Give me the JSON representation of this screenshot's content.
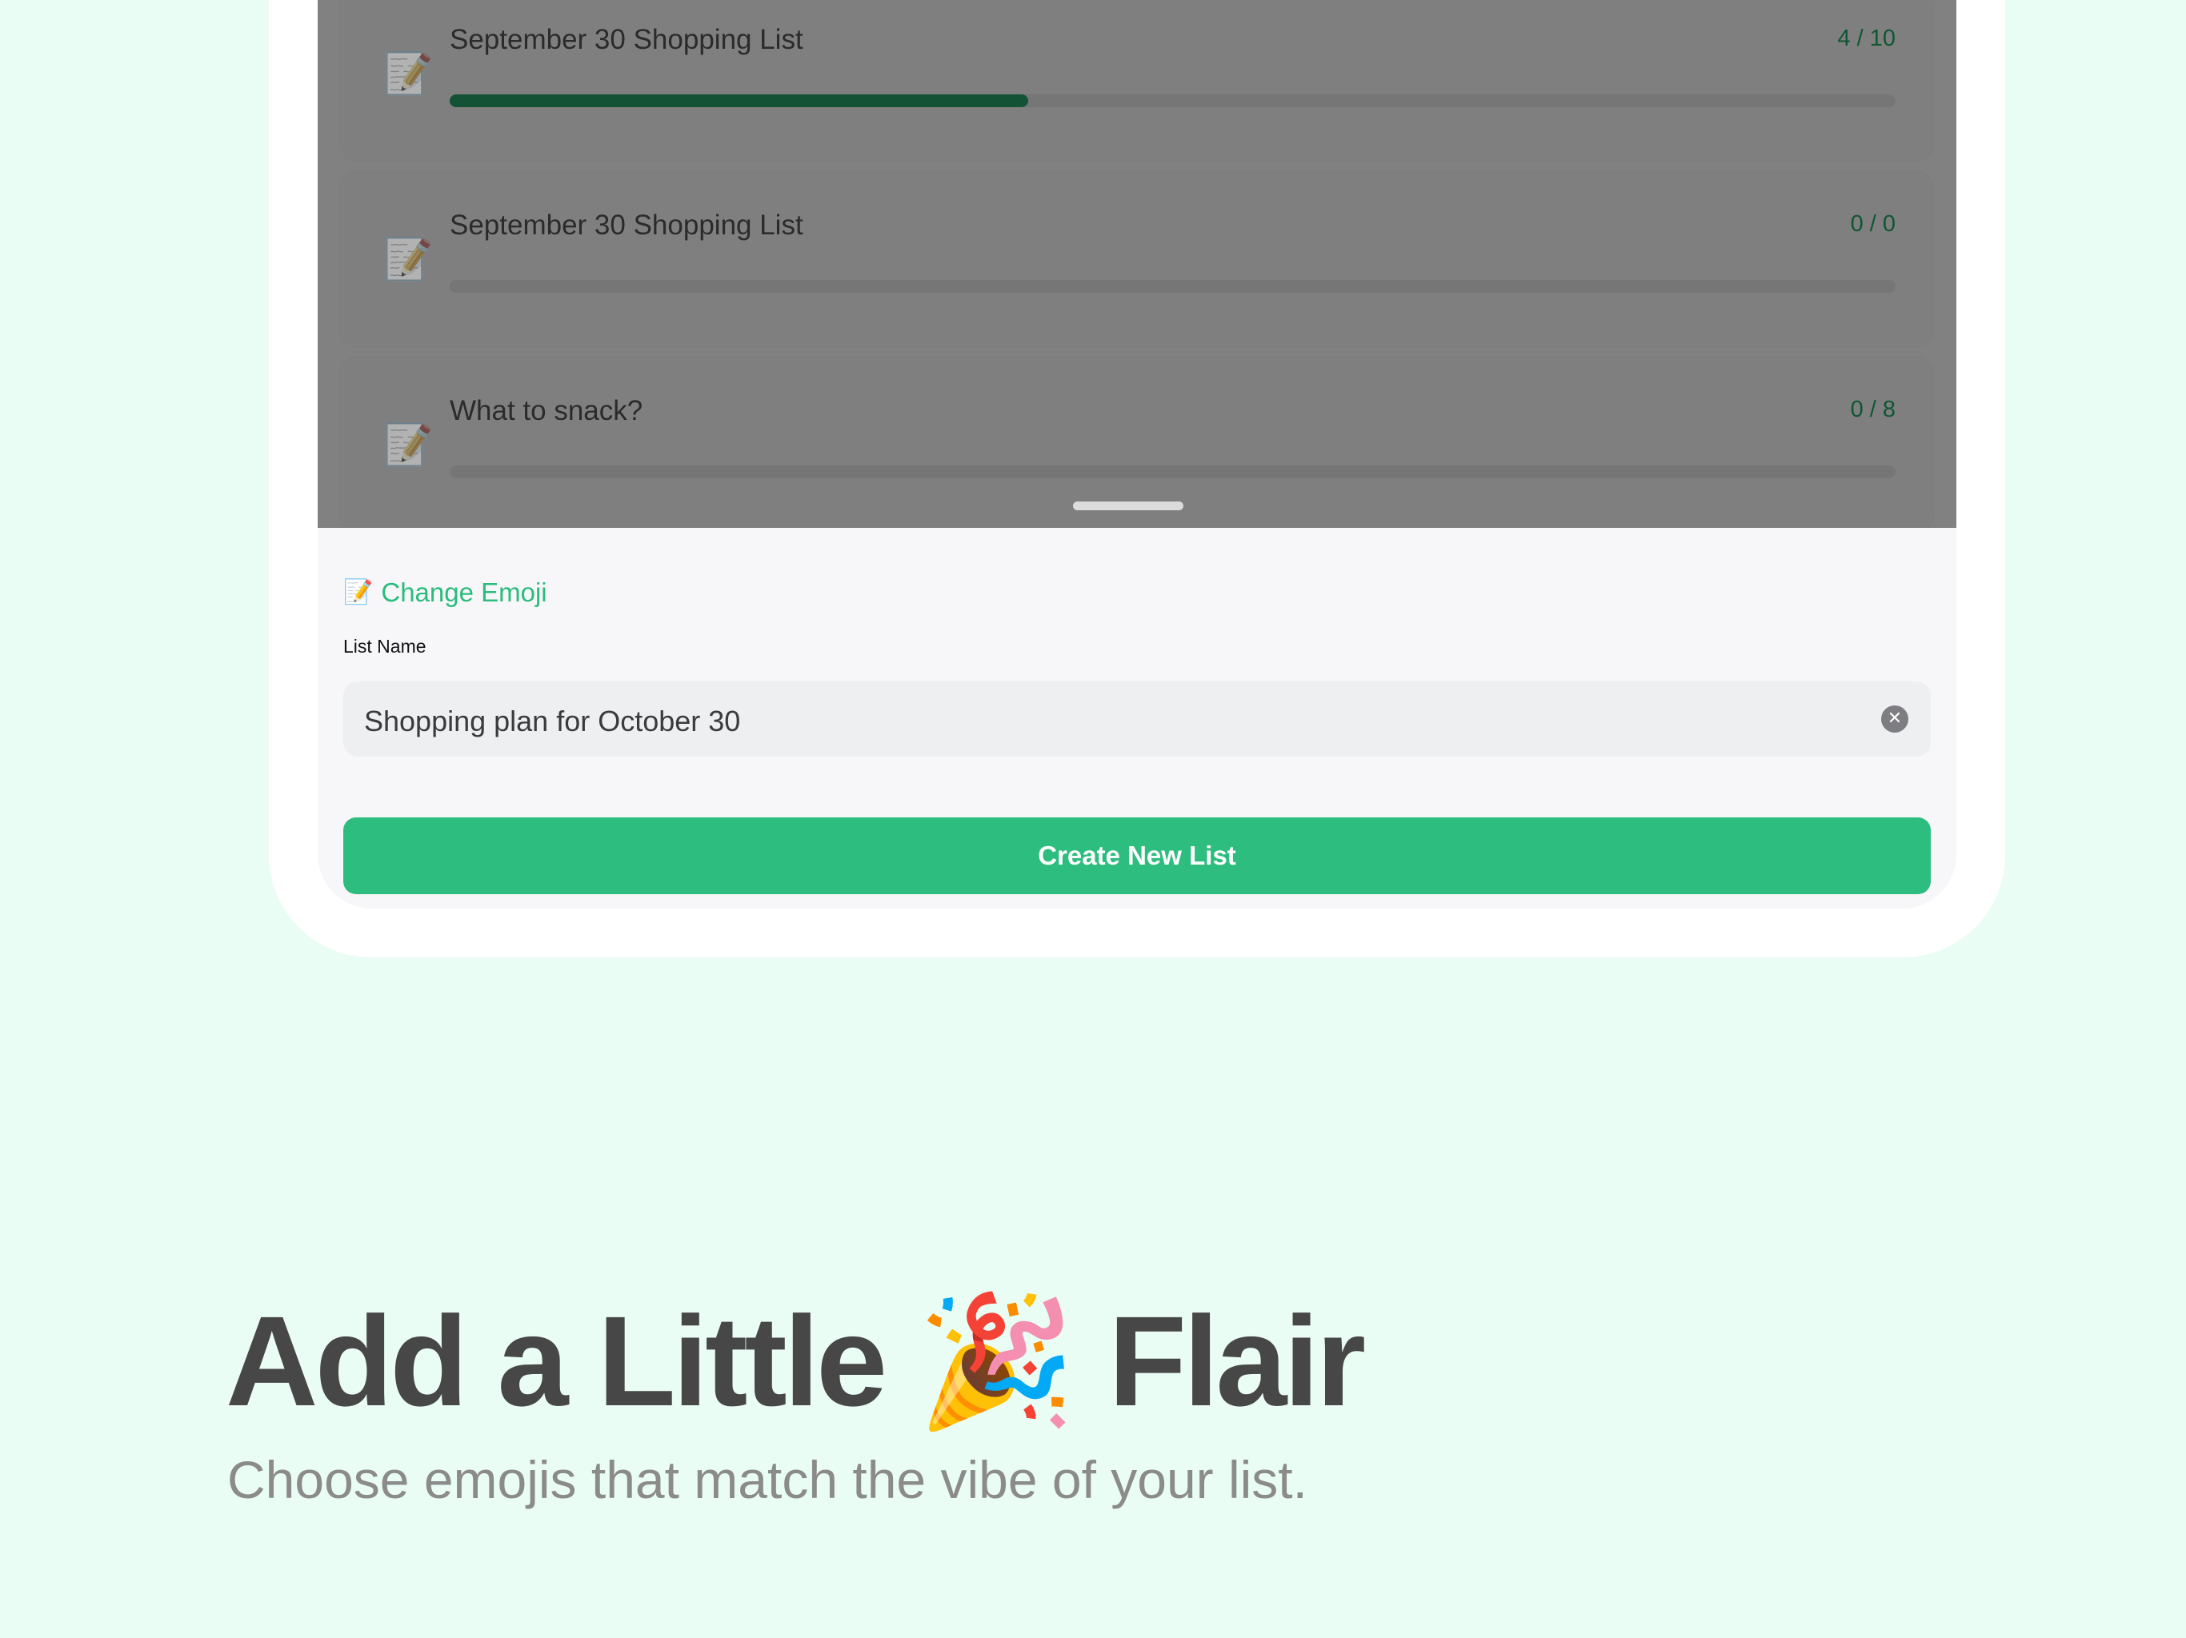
{
  "lists": [
    {
      "emoji": "📝",
      "title": "September 30 Shopping List",
      "count": "4 / 10",
      "progress": 0.4
    },
    {
      "emoji": "📝",
      "title": "September 30 Shopping List",
      "count": "0 / 0",
      "progress": 0
    },
    {
      "emoji": "📝",
      "title": "What to snack?",
      "count": "0 / 8",
      "progress": 0
    }
  ],
  "sheet": {
    "emoji": "📝",
    "change_emoji_label": "Change Emoji",
    "field_label": "List Name",
    "input_value": "Shopping plan for October 30",
    "clear_icon": "✕",
    "create_button_label": "Create New List"
  },
  "marketing": {
    "headline_part1": "Add a Little",
    "headline_emoji": "🎉",
    "headline_part2": "Flair",
    "subline": "Choose emojis that match the vibe of your list."
  },
  "colors": {
    "accent": "#2dbd7e",
    "background": "#eafdf4",
    "progress_fill": "#145236"
  }
}
